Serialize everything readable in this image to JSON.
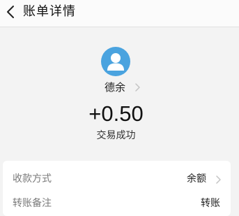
{
  "header": {
    "title": "账单详情",
    "back_icon": "chevron-left-icon"
  },
  "transaction": {
    "avatar_icon": "user-avatar-icon",
    "payer_name": "德余",
    "amount": "+0.50",
    "status": "交易成功"
  },
  "details": [
    {
      "label": "收款方式",
      "value": "余额",
      "has_chevron": true
    },
    {
      "label": "转账备注",
      "value": "转账",
      "has_chevron": false
    }
  ],
  "colors": {
    "avatar": "#4aa3df",
    "background": "#f3f3f3",
    "card": "#ffffff"
  }
}
